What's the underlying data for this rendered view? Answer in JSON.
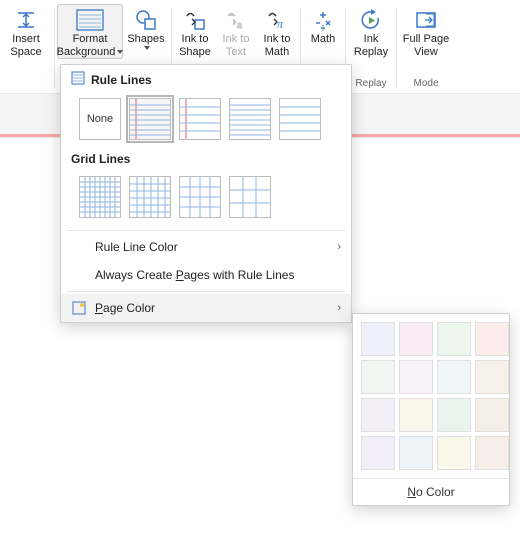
{
  "ribbon": {
    "insert_space": {
      "line1": "Insert",
      "line2": "Space"
    },
    "format_background": {
      "line1": "Format",
      "line2": "Background"
    },
    "shapes": {
      "line1": "Shapes"
    },
    "ink_to_shape": {
      "line1": "Ink to",
      "line2": "Shape"
    },
    "ink_to_text": {
      "line1": "Ink to",
      "line2": "Text"
    },
    "ink_to_math": {
      "line1": "Ink to",
      "line2": "Math"
    },
    "math": {
      "line1": "Math"
    },
    "ink_replay": {
      "line1": "Ink",
      "line2": "Replay"
    },
    "full_page_view": {
      "line1": "Full Page",
      "line2": "View"
    },
    "group_replay": "Replay",
    "group_mode": "Mode"
  },
  "panel": {
    "rule_lines_title": "Rule Lines",
    "grid_lines_title": "Grid Lines",
    "none_label": "None",
    "rule_line_color": "Rule Line Color",
    "always_create": "Always Create Pages with Rule Lines",
    "page_color": "Page Color"
  },
  "flyout": {
    "no_color": "No Color",
    "colors": [
      "#eef0fb",
      "#f9ecf5",
      "#ecf6ed",
      "#fceceb",
      "#f0f7f3",
      "#f9f1f6",
      "#eef6f8",
      "#f8f1ea",
      "#f2eff9",
      "#fcf6ec",
      "#eaf4ef",
      "#f6efe8",
      "#f1eef9",
      "#edf3f9",
      "#faf8ea",
      "#f7eee9"
    ]
  }
}
